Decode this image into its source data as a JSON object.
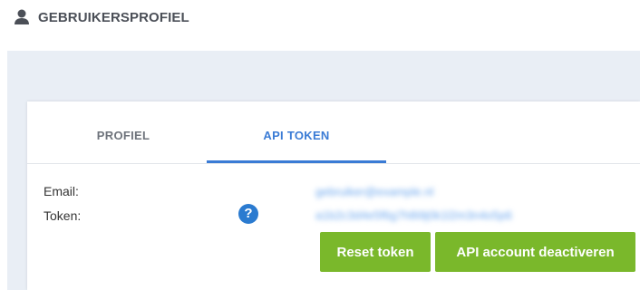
{
  "header": {
    "title": "GEBRUIKERSPROFIEL",
    "icon": "user-icon"
  },
  "tabs": [
    {
      "label": "PROFIEL",
      "active": false
    },
    {
      "label": "API TOKEN",
      "active": true
    }
  ],
  "form": {
    "email_label": "Email:",
    "token_label": "Token:",
    "help_icon": "question-circle-icon",
    "email_value": "gebruiker@example.nl",
    "token_value": "a1b2c3d4e5f6g7h8i9j0k1l2m3n4o5p6"
  },
  "buttons": {
    "reset_label": "Reset token",
    "deactivate_label": "API account deactiveren"
  },
  "colors": {
    "accent_blue": "#3a7bd5",
    "button_green": "#7ab82b",
    "background_grey": "#e9eef5"
  }
}
